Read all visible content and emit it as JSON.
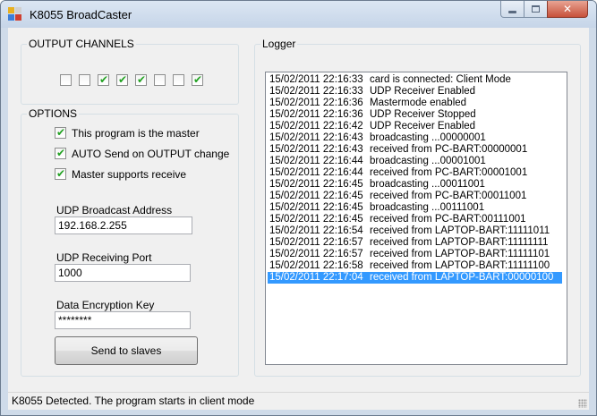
{
  "window": {
    "title": "K8055 BroadCaster",
    "close_glyph": "✕",
    "controls": [
      "minimize-icon",
      "maximize-icon",
      "close-icon"
    ]
  },
  "colors": {
    "frame": "#cfdbe9",
    "client": "#f0f0f0",
    "selection": "#3399ff",
    "check": "#21a121",
    "close_button": "#c7513b"
  },
  "output_channels": {
    "title": "OUTPUT CHANNELS",
    "channels": [
      false,
      false,
      true,
      true,
      true,
      false,
      false,
      true
    ]
  },
  "options": {
    "title": "OPTIONS",
    "master": {
      "label": "This program is the master",
      "checked": true
    },
    "auto_send": {
      "label": "AUTO Send on OUTPUT change",
      "checked": true
    },
    "master_receive": {
      "label": "Master supports receive",
      "checked": true
    },
    "check_glyph": "✔",
    "udp_address": {
      "label": "UDP Broadcast Address",
      "value": "192.168.2.255"
    },
    "udp_port": {
      "label": "UDP Receiving Port",
      "value": "1000"
    },
    "encryption_key": {
      "label": "Data Encryption Key",
      "value": "********"
    },
    "send_button": "Send to slaves"
  },
  "logger": {
    "title": "Logger",
    "selected_index": 17,
    "entries": [
      {
        "time": "15/02/2011 22:16:33",
        "message": "card is connected: Client Mode"
      },
      {
        "time": "15/02/2011 22:16:33",
        "message": "UDP Receiver Enabled"
      },
      {
        "time": "15/02/2011 22:16:36",
        "message": "Mastermode enabled"
      },
      {
        "time": "15/02/2011 22:16:36",
        "message": "UDP Receiver Stopped"
      },
      {
        "time": "15/02/2011 22:16:42",
        "message": "UDP Receiver Enabled"
      },
      {
        "time": "15/02/2011 22:16:43",
        "message": "broadcasting ...00000001"
      },
      {
        "time": "15/02/2011 22:16:43",
        "message": "received from PC-BART:00000001"
      },
      {
        "time": "15/02/2011 22:16:44",
        "message": "broadcasting ...00001001"
      },
      {
        "time": "15/02/2011 22:16:44",
        "message": "received from PC-BART:00001001"
      },
      {
        "time": "15/02/2011 22:16:45",
        "message": "broadcasting ...00011001"
      },
      {
        "time": "15/02/2011 22:16:45",
        "message": "received from PC-BART:00011001"
      },
      {
        "time": "15/02/2011 22:16:45",
        "message": "broadcasting ...00111001"
      },
      {
        "time": "15/02/2011 22:16:45",
        "message": "received from PC-BART:00111001"
      },
      {
        "time": "15/02/2011 22:16:54",
        "message": "received from LAPTOP-BART:11111011"
      },
      {
        "time": "15/02/2011 22:16:57",
        "message": "received from LAPTOP-BART:11111111"
      },
      {
        "time": "15/02/2011 22:16:57",
        "message": "received from LAPTOP-BART:11111101"
      },
      {
        "time": "15/02/2011 22:16:58",
        "message": "received from LAPTOP-BART:11111100"
      },
      {
        "time": "15/02/2011 22:17:04",
        "message": "received from LAPTOP-BART:00000100"
      }
    ]
  },
  "status": {
    "text": "K8055 Detected. The program starts in client mode"
  }
}
